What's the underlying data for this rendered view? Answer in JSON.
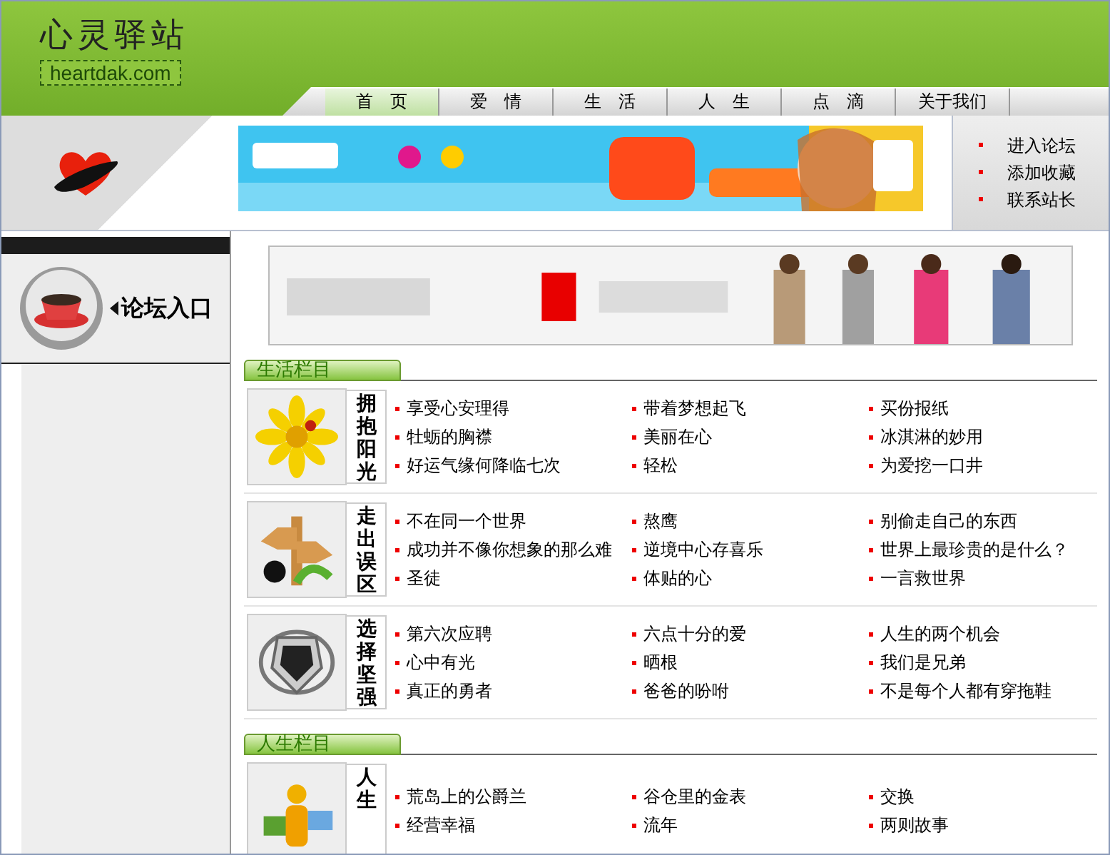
{
  "logo": {
    "title": "心灵驿站",
    "domain": "heartdak.com"
  },
  "nav": [
    {
      "label": "首　页",
      "selected": true
    },
    {
      "label": "爱　情",
      "selected": false
    },
    {
      "label": "生　活",
      "selected": false
    },
    {
      "label": "人　生",
      "selected": false
    },
    {
      "label": "点　滴",
      "selected": false
    },
    {
      "label": "关于我们",
      "selected": false
    }
  ],
  "quick_links": [
    "进入论坛",
    "添加收藏",
    "联系站长"
  ],
  "forum_entry": {
    "label": "论坛入口"
  },
  "sections": [
    {
      "title": "生活栏目",
      "groups": [
        {
          "label": "拥抱阳光",
          "kind": "flower",
          "links": [
            "享受心安理得",
            "带着梦想起飞",
            "买份报纸",
            "牡蛎的胸襟",
            "美丽在心",
            "冰淇淋的妙用",
            "好运气缘何降临七次",
            "轻松",
            "为爱挖一口井"
          ]
        },
        {
          "label": "走出误区",
          "kind": "signpost",
          "links": [
            "不在同一个世界",
            "熬鹰",
            "别偷走自己的东西",
            "成功并不像你想象的那么难",
            "逆境中心存喜乐",
            "世界上最珍贵的是什么？",
            "圣徒",
            "体贴的心",
            "一言救世界"
          ]
        },
        {
          "label": "选择坚强",
          "kind": "shield",
          "links": [
            "第六次应聘",
            "六点十分的爱",
            "人生的两个机会",
            "心中有光",
            "晒根",
            "我们是兄弟",
            "真正的勇者",
            "爸爸的吩咐",
            "不是每个人都有穿拖鞋"
          ]
        }
      ]
    },
    {
      "title": "人生栏目",
      "groups": [
        {
          "label": "人生",
          "kind": "figure",
          "links": [
            "荒岛上的公爵兰",
            "谷仓里的金表",
            "交换",
            "经营幸福",
            "流年",
            "两则故事"
          ]
        }
      ]
    }
  ]
}
